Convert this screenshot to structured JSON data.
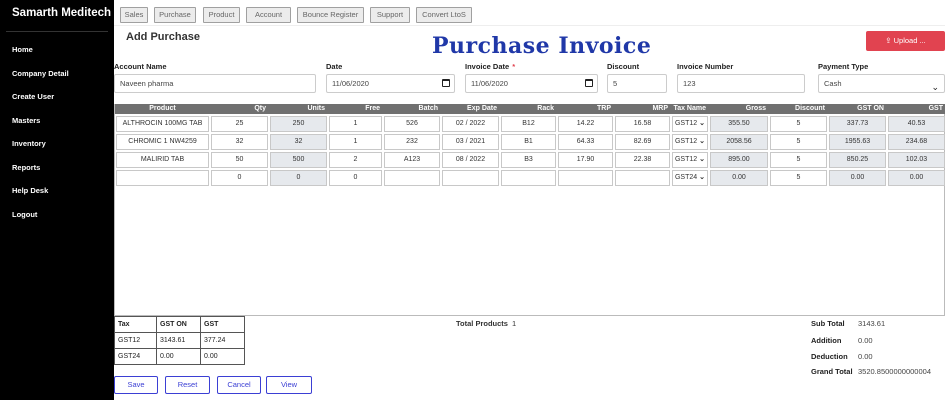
{
  "sidebar": {
    "brand": "Samarth Meditech",
    "items": [
      "Home",
      "Company Detail",
      "Create User",
      "Masters",
      "Inventory",
      "Reports",
      "Help Desk",
      "Logout"
    ]
  },
  "topbar": {
    "buttons": [
      "Sales",
      "Purchase",
      "Product",
      "Account",
      "Bounce Register",
      "Support",
      "Convert LtoS"
    ]
  },
  "page": {
    "subtitle": "Add Purchase",
    "title": "Purchase Invoice",
    "upload_label": "⇪ Upload ..."
  },
  "form": {
    "account_label": "Account Name",
    "account_value": "Naveen pharma",
    "date_label": "Date",
    "date_value": "11/06/2020",
    "invoice_date_label": "Invoice Date",
    "invoice_date_required": "*",
    "invoice_date_value": "11/06/2020",
    "discount_label": "Discount",
    "discount_value": "5",
    "invoice_number_label": "Invoice Number",
    "invoice_number_value": "123",
    "payment_type_label": "Payment Type",
    "payment_type_value": "Cash"
  },
  "grid": {
    "headers": [
      "Product",
      "Qty",
      "Units",
      "Free",
      "Batch",
      "Exp Date",
      "Rack",
      "TRP",
      "MRP",
      "Tax Name",
      "Gross",
      "Discount",
      "GST ON",
      "GST"
    ],
    "rows": [
      [
        "ALTHROCIN 100MG TAB",
        "25",
        "250",
        "1",
        "526",
        "02 / 2022",
        "B12",
        "14.22",
        "16.58",
        "GST12",
        "355.50",
        "5",
        "337.73",
        "40.53"
      ],
      [
        "CHROMIC 1 NW4259",
        "32",
        "32",
        "1",
        "232",
        "03 / 2021",
        "B1",
        "64.33",
        "82.69",
        "GST12",
        "2058.56",
        "5",
        "1955.63",
        "234.68"
      ],
      [
        "MALIRID TAB",
        "50",
        "500",
        "2",
        "A123",
        "08 / 2022",
        "B3",
        "17.90",
        "22.38",
        "GST12",
        "895.00",
        "5",
        "850.25",
        "102.03"
      ],
      [
        "",
        "0",
        "0",
        "0",
        "",
        "",
        "",
        "",
        "",
        "GST24",
        "0.00",
        "5",
        "0.00",
        "0.00"
      ]
    ]
  },
  "tax_summary": {
    "headers": [
      "Tax",
      "GST ON",
      "GST"
    ],
    "rows": [
      [
        "GST12",
        "3143.61",
        "377.24"
      ],
      [
        "GST24",
        "0.00",
        "0.00"
      ]
    ]
  },
  "totals": {
    "total_products_label": "Total Products",
    "total_products_value": "1",
    "sub_total_label": "Sub Total",
    "sub_total_value": "3143.61",
    "addition_label": "Addition",
    "addition_value": "0.00",
    "deduction_label": "Deduction",
    "deduction_value": "0.00",
    "grand_total_label": "Grand Total",
    "grand_total_value": "3520.8500000000004"
  },
  "footer": {
    "buttons": [
      "Save",
      "Reset",
      "Cancel",
      "View"
    ]
  }
}
